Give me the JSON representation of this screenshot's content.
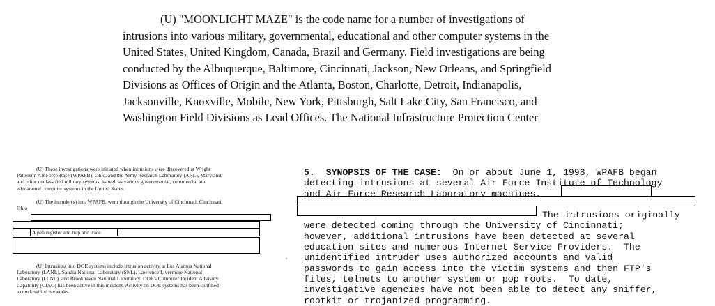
{
  "top_paragraph": {
    "lines": [
      "(U) \"MOONLIGHT MAZE\" is the code name for a number of investigations of",
      "intrusions into various military, governmental, educational and other computer systems in the",
      "United States, United Kingdom, Canada, Brazil and Germany.  Field investigations are being",
      "conducted by the Albuquerque,  Baltimore, Cincinnati, Jackson, New Orleans, and Springfield",
      "Divisions as Offices of Origin and the Atlanta, Boston, Charlotte, Detroit, Indianapolis,",
      "Jacksonville, Knoxville, Mobile, New York, Pittsburgh, Salt Lake City, San Francisco, and",
      "Washington Field Divisions as Lead Offices.  The National Infrastructure Protection Center"
    ]
  },
  "left_column": {
    "para1": [
      "(U) These investigations were initiated when intrusions were discovered at Wright",
      "Patterson Air Force Base (WPAFB), Ohio, and the Army Research Laboratory (ARL), Maryland,",
      "and other unclassified military systems, as well as various governmental, commercial and",
      "educational computer systems in the United States."
    ],
    "para2_line1": "(U) The intruder(s) into WPAFB, went through the University of Cincinnati, Cincinnati,",
    "para2_ohio": "Ohio",
    "para2_pen": "A pen register and trap and trace",
    "para3": [
      "(U) Intrusions into DOE systems include intrusion activity at Los Alamos National",
      "Laboratory (LANL), Sandia National Laboratory (SNL), Lawrence Livermore National",
      "Laboratory (LLNL), and Brookhaven National Laboratory.  DOE's Computer Incident Advisory",
      "Capability (CIAC) has been active in this incident.  Activity on DOE systems has been confined",
      "to unclassified networks."
    ]
  },
  "right_column": {
    "heading_label": "5.  SYNOPSIS OF THE CASE:",
    "line1_rest": "  On or about June 1, 1998, WPAFB began",
    "line2": "detecting intrusions at several Air Force Institute of Technology",
    "line3": "and Air Force Research Laboratory machines.",
    "line5_rest": "The intrusions originally",
    "lines": [
      "were detected coming through the University of Cincinnati;",
      "however, additional intrusions have been detected at several",
      "education sites and numerous Internet Service Providers.  The",
      "unidentified intruder uses authorized accounts and valid",
      "passwords to gain access into the victim systems and then FTP's",
      "files, telnets to another system or pop roots.  To date,",
      "investigative agencies have not been able to detect any sniffer,",
      "rootkit or trojanized programming."
    ]
  }
}
